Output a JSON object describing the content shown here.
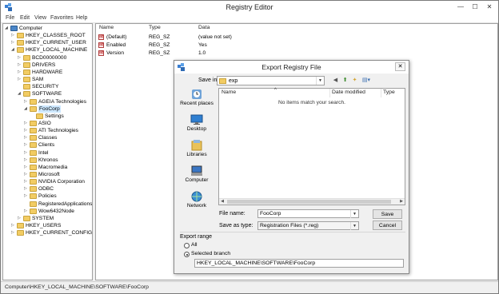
{
  "window": {
    "title": "Registry Editor",
    "minimize": "—",
    "maximize": "☐",
    "close": "✕"
  },
  "menu": [
    "File",
    "Edit",
    "View",
    "Favorites",
    "Help"
  ],
  "tree": [
    {
      "label": "Computer",
      "level": 0,
      "arrow": "◢"
    },
    {
      "label": "HKEY_CLASSES_ROOT",
      "level": 1,
      "arrow": "▷"
    },
    {
      "label": "HKEY_CURRENT_USER",
      "level": 1,
      "arrow": "▷"
    },
    {
      "label": "HKEY_LOCAL_MACHINE",
      "level": 1,
      "arrow": "◢"
    },
    {
      "label": "BCD00000000",
      "level": 2,
      "arrow": "▷"
    },
    {
      "label": "DRIVERS",
      "level": 2,
      "arrow": "▷"
    },
    {
      "label": "HARDWARE",
      "level": 2,
      "arrow": "▷"
    },
    {
      "label": "SAM",
      "level": 2,
      "arrow": "▷"
    },
    {
      "label": "SECURITY",
      "level": 2,
      "arrow": ""
    },
    {
      "label": "SOFTWARE",
      "level": 2,
      "arrow": "◢"
    },
    {
      "label": "AGEIA Technologies",
      "level": 3,
      "arrow": "▷"
    },
    {
      "label": "FooCorp",
      "level": 3,
      "arrow": "◢",
      "selected": true
    },
    {
      "label": "Settings",
      "level": 4,
      "arrow": ""
    },
    {
      "label": "ASIO",
      "level": 3,
      "arrow": "▷"
    },
    {
      "label": "ATI Technologies",
      "level": 3,
      "arrow": "▷"
    },
    {
      "label": "Classes",
      "level": 3,
      "arrow": "▷"
    },
    {
      "label": "Clients",
      "level": 3,
      "arrow": "▷"
    },
    {
      "label": "Intel",
      "level": 3,
      "arrow": "▷"
    },
    {
      "label": "Khronos",
      "level": 3,
      "arrow": "▷"
    },
    {
      "label": "Macromedia",
      "level": 3,
      "arrow": "▷"
    },
    {
      "label": "Microsoft",
      "level": 3,
      "arrow": "▷"
    },
    {
      "label": "NVIDIA Corporation",
      "level": 3,
      "arrow": "▷"
    },
    {
      "label": "ODBC",
      "level": 3,
      "arrow": "▷"
    },
    {
      "label": "Policies",
      "level": 3,
      "arrow": "▷"
    },
    {
      "label": "RegisteredApplications",
      "level": 3,
      "arrow": ""
    },
    {
      "label": "Wow6432Node",
      "level": 3,
      "arrow": "▷"
    },
    {
      "label": "SYSTEM",
      "level": 2,
      "arrow": "▷"
    },
    {
      "label": "HKEY_USERS",
      "level": 1,
      "arrow": "▷"
    },
    {
      "label": "HKEY_CURRENT_CONFIG",
      "level": 1,
      "arrow": "▷"
    }
  ],
  "list": {
    "headers": {
      "name": "Name",
      "type": "Type",
      "data": "Data"
    },
    "rows": [
      {
        "name": "(Default)",
        "type": "REG_SZ",
        "data": "(value not set)"
      },
      {
        "name": "Enabled",
        "type": "REG_SZ",
        "data": "Yes"
      },
      {
        "name": "Version",
        "type": "REG_SZ",
        "data": "1.0"
      }
    ]
  },
  "status": "Computer\\HKEY_LOCAL_MACHINE\\SOFTWARE\\FooCorp",
  "dialog": {
    "title": "Export Registry File",
    "close": "✕",
    "save_in_label": "Save in:",
    "save_in_value": "exp",
    "places": [
      "Recent places",
      "Desktop",
      "Libraries",
      "Computer",
      "Network"
    ],
    "columns": {
      "name": "Name",
      "date": "Date modified",
      "type": "Type"
    },
    "empty_message": "No items match your search.",
    "file_name_label": "File name:",
    "file_name_value": "FooCorp",
    "save_type_label": "Save as type:",
    "save_type_value": "Registration Files (*.reg)",
    "save_button": "Save",
    "cancel_button": "Cancel",
    "export_range_label": "Export range",
    "all_label": "All",
    "selected_branch_label": "Selected branch",
    "branch_value": "HKEY_LOCAL_MACHINE\\SOFTWARE\\FooCorp"
  }
}
